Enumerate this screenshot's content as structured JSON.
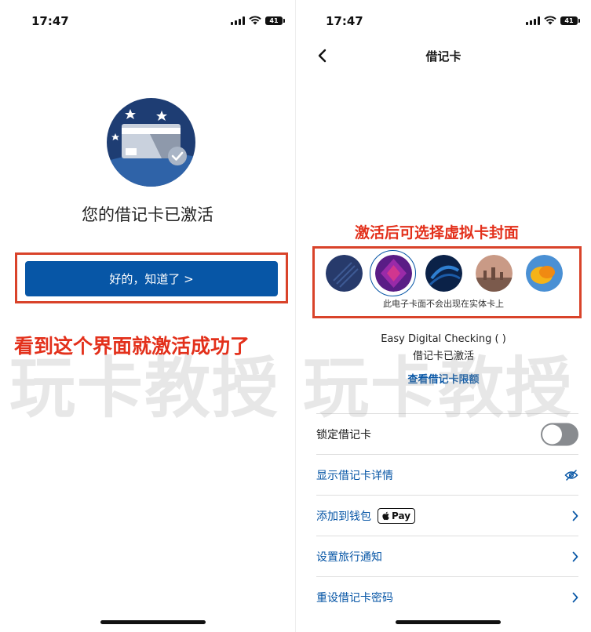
{
  "left": {
    "time": "17:47",
    "battery": "41",
    "title": "您的借记卡已激活",
    "ok_button": "好的，知道了 >",
    "annotation": "看到这个界面就激活成功了"
  },
  "right": {
    "time": "17:47",
    "battery": "41",
    "nav_title": "借记卡",
    "annotation": "激活后可选择虚拟卡封面",
    "covers_note": "此电子卡面不会出现在实体卡上",
    "account_name": "Easy Digital Checking (      )",
    "account_status": "借记卡已激活",
    "view_limits": "查看借记卡限额",
    "rows": [
      {
        "label": "锁定借记卡",
        "trail": "toggle",
        "toggle_on": false
      },
      {
        "label": "显示借记卡详情",
        "trail": "eye-slash-icon"
      },
      {
        "label": "添加到钱包",
        "trail": "chevron-right-icon",
        "badge": "Pay"
      },
      {
        "label": "设置旅行通知",
        "trail": "chevron-right-icon"
      },
      {
        "label": "重设借记卡密码",
        "trail": "chevron-right-icon"
      }
    ]
  },
  "watermark": "玩卡教授",
  "colors": {
    "primary_blue": "#0756a6",
    "annotation_red": "#e3301b",
    "navy": "#1e3d73"
  }
}
